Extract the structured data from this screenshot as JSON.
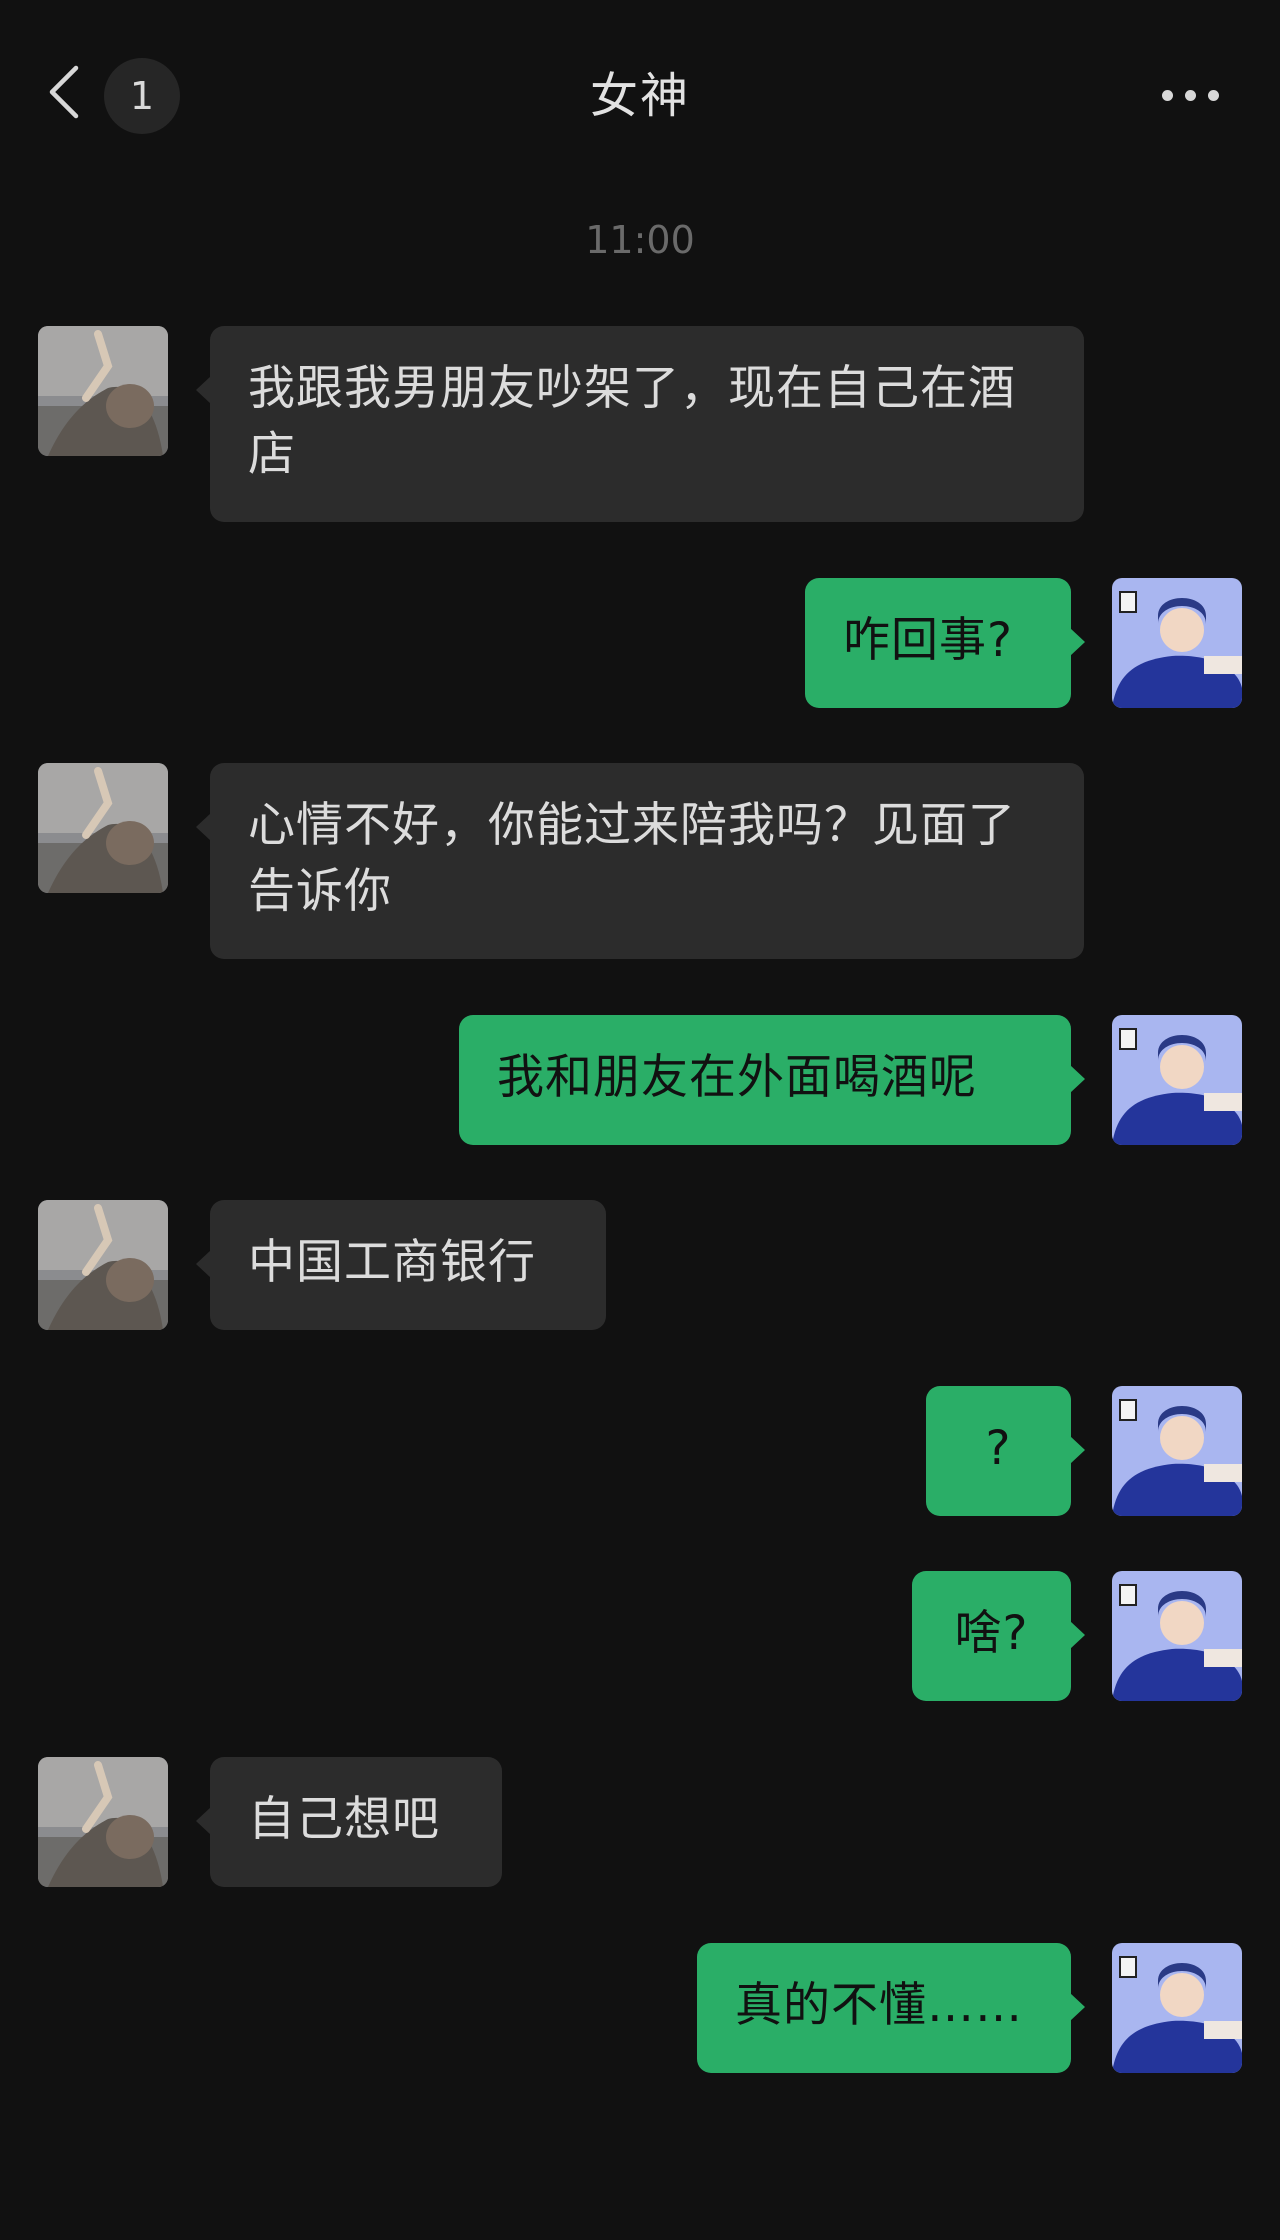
{
  "header": {
    "title": "女神",
    "unread_count": "1",
    "back_icon": "chevron-left-icon",
    "more_icon": "more-dots-icon"
  },
  "chat": {
    "timestamp": "11:00",
    "messages": [
      {
        "side": "in",
        "text": "我跟我男朋友吵架了，现在自己在酒店"
      },
      {
        "side": "out",
        "text": "咋回事?"
      },
      {
        "side": "in",
        "text": "心情不好，你能过来陪我吗？见面了告诉你"
      },
      {
        "side": "out",
        "text": "我和朋友在外面喝酒呢"
      },
      {
        "side": "in",
        "text": "中国工商银行"
      },
      {
        "side": "out",
        "text": "?"
      },
      {
        "side": "out",
        "text": "啥?"
      },
      {
        "side": "in",
        "text": "自己想吧"
      },
      {
        "side": "out",
        "text": "真的不懂……"
      }
    ]
  },
  "colors": {
    "background": "#111111",
    "incoming_bubble": "#2c2c2c",
    "outgoing_bubble": "#2aae67"
  }
}
